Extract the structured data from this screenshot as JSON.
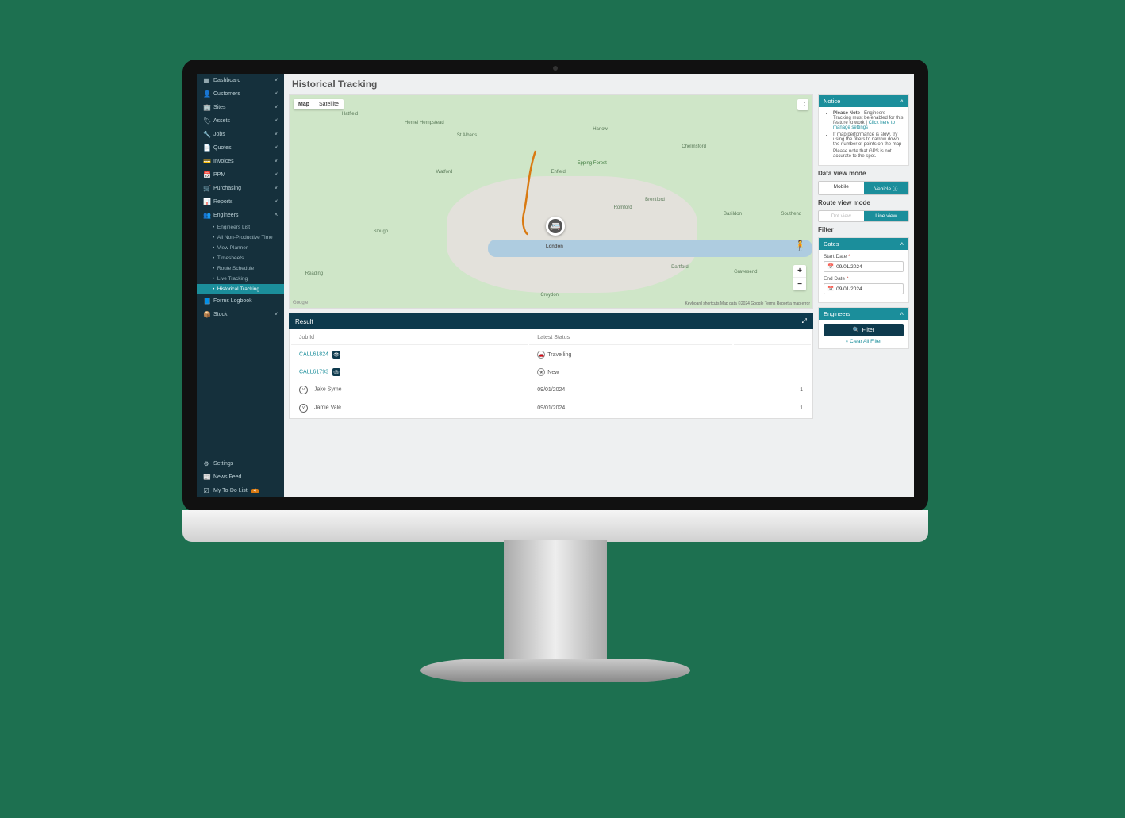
{
  "page": {
    "title": "Historical Tracking"
  },
  "sidebar": {
    "items": [
      {
        "icon": "▦",
        "label": "Dashboard",
        "expandable": true
      },
      {
        "icon": "👤",
        "label": "Customers",
        "expandable": true
      },
      {
        "icon": "🏢",
        "label": "Sites",
        "expandable": true
      },
      {
        "icon": "🏷",
        "label": "Assets",
        "expandable": true
      },
      {
        "icon": "🔧",
        "label": "Jobs",
        "expandable": true
      },
      {
        "icon": "📄",
        "label": "Quotes",
        "expandable": true
      },
      {
        "icon": "💳",
        "label": "Invoices",
        "expandable": true
      },
      {
        "icon": "📅",
        "label": "PPM",
        "expandable": true
      },
      {
        "icon": "🛒",
        "label": "Purchasing",
        "expandable": true
      },
      {
        "icon": "📊",
        "label": "Reports",
        "expandable": true
      },
      {
        "icon": "👥",
        "label": "Engineers",
        "expandable": true,
        "open": true
      }
    ],
    "engineers_sub": [
      {
        "label": "Engineers List"
      },
      {
        "label": "All Non-Productive Time"
      },
      {
        "label": "View Planner"
      },
      {
        "label": "Timesheets"
      },
      {
        "label": "Route Schedule"
      },
      {
        "label": "Live Tracking"
      },
      {
        "label": "Historical Tracking",
        "active": true
      }
    ],
    "after": [
      {
        "icon": "📘",
        "label": "Forms Logbook"
      },
      {
        "icon": "📦",
        "label": "Stock",
        "expandable": true
      }
    ],
    "bottom": [
      {
        "icon": "⚙",
        "label": "Settings"
      },
      {
        "icon": "📰",
        "label": "News Feed"
      },
      {
        "icon": "☑",
        "label": "My To-Do List",
        "badge": "4"
      }
    ]
  },
  "map": {
    "tabs": {
      "map": "Map",
      "satellite": "Satellite"
    },
    "places": [
      "Hatfield",
      "Watford",
      "St Albans",
      "Chelmsford",
      "Slough",
      "Reading",
      "London",
      "Croydon",
      "Dartford",
      "Gravesend",
      "Brentford",
      "Hemel Hempstead",
      "Harlow",
      "Enfield",
      "Romford",
      "Basildon",
      "Epping Forest",
      "Southend"
    ],
    "attribution": "Keyboard shortcuts   Map data ©2024 Google   Terms   Report a map error",
    "glogo": "Google"
  },
  "result": {
    "title": "Result",
    "columns": {
      "job": "Job Id",
      "status": "Latest Status",
      "date": "",
      "count": ""
    },
    "rows": [
      {
        "job": "CALL61824",
        "kind": "job",
        "status": "Travelling",
        "eye": true
      },
      {
        "job": "CALL61793",
        "kind": "job",
        "status": "New",
        "eye": true
      },
      {
        "job": "Jake Syme",
        "kind": "eng",
        "date": "09/01/2024",
        "count": "1"
      },
      {
        "job": "Jamie Vale",
        "kind": "eng",
        "date": "09/01/2024",
        "count": "1"
      }
    ]
  },
  "notice": {
    "title": "Notice",
    "items": [
      {
        "bold": "Please Note",
        "text": " : Engineers Tracking must be enabled for this feature to work | ",
        "link": "Click here to manage settings"
      },
      {
        "text": "If map performance is slow, try using the filters to narrow down the number of points on the map"
      },
      {
        "text": "Please note that GPS is not accurate to the spot."
      }
    ]
  },
  "data_view": {
    "label": "Data view mode",
    "mobile": "Mobile",
    "vehicle": "Vehicle ⓘ"
  },
  "route_view": {
    "label": "Route view mode",
    "dot": "Dot view",
    "line": "Line view"
  },
  "filter": {
    "label": "Filter",
    "dates_title": "Dates",
    "start_label": "Start Date",
    "end_label": "End Date",
    "start_value": "09/01/2024",
    "end_value": "09/01/2024",
    "engineers_title": "Engineers",
    "filter_btn": "Filter",
    "clear": "× Clear All Filter"
  }
}
